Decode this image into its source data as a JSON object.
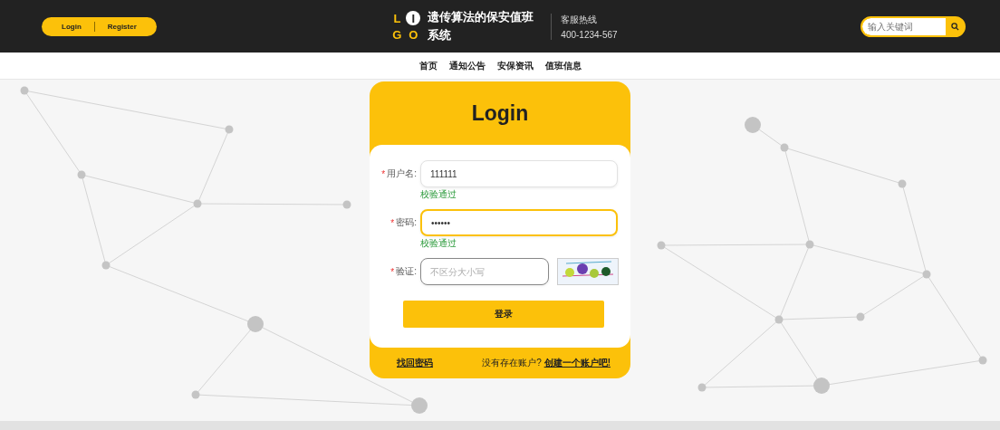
{
  "header": {
    "auth_buttons": [
      "Login",
      "Register"
    ],
    "logo_letters": [
      "L",
      "I",
      "G",
      "O"
    ],
    "site_title": "遗传算法的保安值班系统",
    "hotline_label": "客服热线",
    "hotline_number": "400-1234-567",
    "search": {
      "placeholder": "输入关键词"
    }
  },
  "nav": {
    "items": [
      "首页",
      "通知公告",
      "安保资讯",
      "值班信息"
    ]
  },
  "login_card": {
    "title": "Login",
    "required_mark": "*",
    "fields": [
      {
        "kind": "text",
        "label": "用户名:",
        "required": true,
        "value": "111111",
        "focused": false,
        "hint": "校验通过"
      },
      {
        "kind": "password",
        "label": "密码:",
        "required": true,
        "value": "••••••",
        "focused": true,
        "hint": "校验通过"
      },
      {
        "kind": "captcha",
        "label": "验证:",
        "required": true,
        "placeholder": "不区分大小写",
        "focused": false
      }
    ],
    "submit": "登录",
    "forgot_link": "找回密码",
    "signup_prompt": "没有存在账户?",
    "signup_link": "创建一个账户吧!"
  }
}
